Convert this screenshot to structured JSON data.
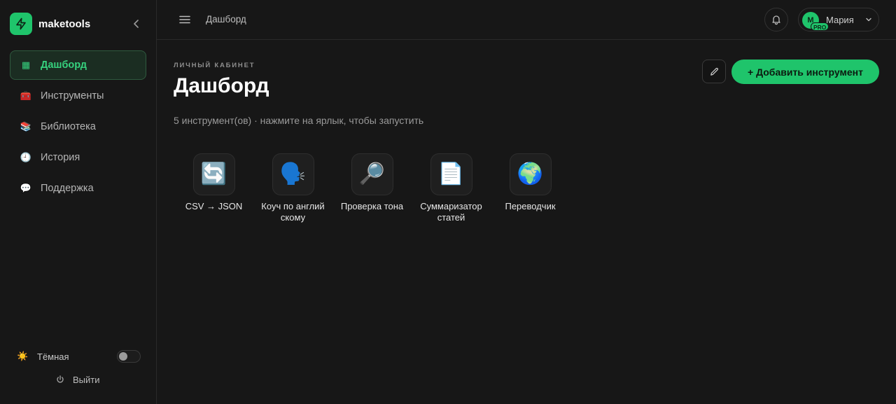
{
  "brand": {
    "name": "maketools",
    "color": "#1fc46b"
  },
  "sidebar": {
    "items": [
      {
        "icon": "▦",
        "icon_name": "dashboard-icon",
        "label": "Дашборд",
        "active": true
      },
      {
        "icon": "🧰",
        "icon_name": "toolbox-icon",
        "label": "Инструменты",
        "active": false
      },
      {
        "icon": "📚",
        "icon_name": "books-icon",
        "label": "Библиотека",
        "active": false
      },
      {
        "icon": "🕘",
        "icon_name": "clock-icon",
        "label": "История",
        "active": false
      },
      {
        "icon": "💬",
        "icon_name": "chat-bubble-icon",
        "label": "Поддержка",
        "active": false
      }
    ],
    "theme": {
      "icon": "☀️",
      "label": "Тёмная",
      "enabled": false
    },
    "logout_label": "Выйти"
  },
  "topbar": {
    "title": "Дашборд",
    "user": {
      "initial": "М",
      "badge": "PRO",
      "name": "Мария"
    }
  },
  "main": {
    "eyebrow": "Личный кабинет",
    "title": "Дашборд",
    "subtitle": "5 инструмент(ов) · нажмите на ярлык, чтобы запустить",
    "add_button_label": "+ Добавить инструмент",
    "tools": [
      {
        "emoji": "🔄",
        "icon_name": "arrows-cycle-icon",
        "label": "CSV → JSON"
      },
      {
        "emoji": "🗣️",
        "icon_name": "speaking-head-icon",
        "label": "Коуч по английскому"
      },
      {
        "emoji": "🔎",
        "icon_name": "magnifier-icon",
        "label": "Проверка тона"
      },
      {
        "emoji": "📄",
        "icon_name": "document-icon",
        "label": "Суммаризатор статей"
      },
      {
        "emoji": "🌍",
        "icon_name": "globe-icon",
        "label": "Переводчик"
      }
    ]
  },
  "colors": {
    "accent": "#1fc46b",
    "background": "#171717",
    "active_nav_bg": "#1b2d22"
  }
}
